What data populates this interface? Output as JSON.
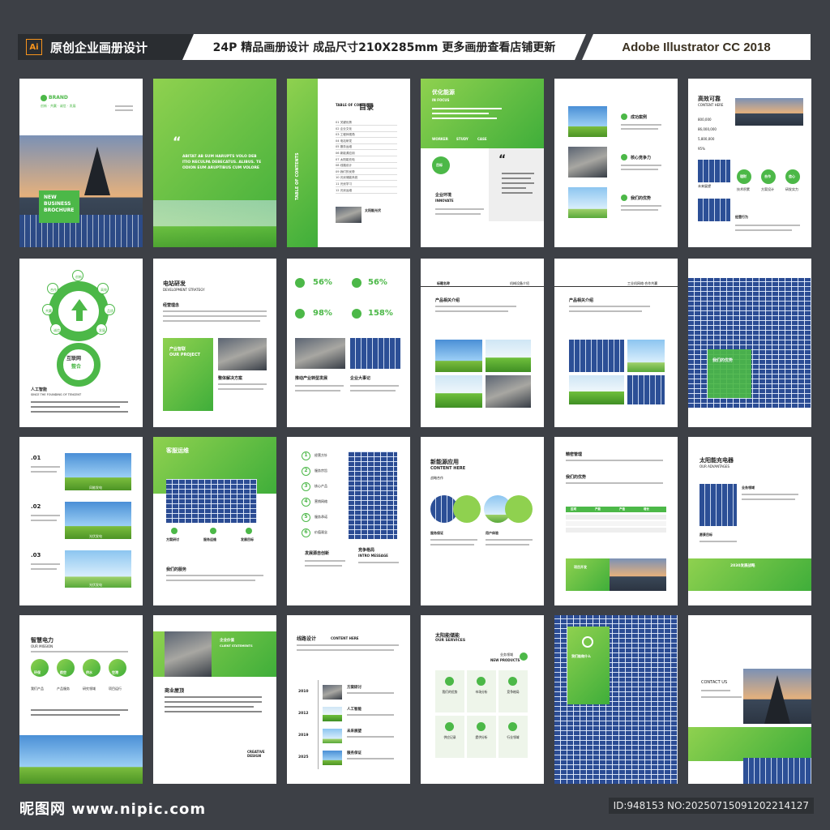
{
  "header": {
    "app_badge": "Ai",
    "left_title": "原创企业画册设计",
    "center_text": "24P 精品画册设计 成品尺寸210X285mm 更多画册查看店铺更新",
    "right_text": "Adobe Illustrator CC 2018"
  },
  "footer": {
    "site": "昵图网 www.nipic.com",
    "id_text": "ID:948153 NO:20250715091202214127"
  },
  "p1": {
    "brand": "BRAND",
    "tagline": "创新 · 共赢 · 诚信 · 发展",
    "cover_title_1": "NEW",
    "cover_title_2": "BUSINESS",
    "cover_title_3": "BROCHURE"
  },
  "p2": {
    "quote": "“",
    "body": "ABITAT AB SUM HARUPTS VOLO DEB ITIO NECULPA DEBECATUS. ALIBUS. TE ODION EUM ARUPTIBUS CUM VOLORE"
  },
  "p3": {
    "side": "TABLE OF CONTENTS",
    "toc_en": "TABLE OF CONTENTS",
    "toc_cn": "目录",
    "items": [
      "01 关键优势",
      "02 企业文化",
      "03 工程师视角",
      "04 电站研发",
      "05 服务运维",
      "06 新能源应用",
      "07 太阳能充电",
      "08 线路设计",
      "09 我们的优势",
      "10 光伏储能系统",
      "11 光伏学习",
      "12 光伏运维"
    ],
    "caption": "太阳能光伏"
  },
  "p4": {
    "title": "优化能源",
    "subtitle": "IN FOCUS",
    "tabs": [
      "WORKER",
      "STUDY",
      "CASE"
    ],
    "badge": "目标",
    "label": "企业环境",
    "label_en": "INNOVATE"
  },
  "p5": {
    "items": [
      "成功案例",
      "核心竞争力",
      "我们的优势"
    ]
  },
  "p6": {
    "title": "高效可靠",
    "subtitle": "CONTENT HERE",
    "stats": [
      "800,000",
      "86,000,000",
      "5,800,000",
      "95%"
    ],
    "icons": [
      "理财",
      "合作",
      "信心"
    ],
    "labels": [
      "未来展望",
      "技术积累",
      "方案设计",
      "研发实力"
    ],
    "footer": "经营行为"
  },
  "p7": {
    "nodes": [
      "创新",
      "合作",
      "高效",
      "共赢",
      "品质",
      "诚信",
      "发展"
    ],
    "center_1": "互联网",
    "center_2": "整合",
    "title": "人工智能",
    "subtitle": "SINCE THE FOUNDING OF TENCENT"
  },
  "p8": {
    "title": "电站研发",
    "subtitle": "DEVELOPMENT STRATEGY",
    "head": "经营理念",
    "box_title": "产业智联",
    "box_en": "OUR PROJECT",
    "label": "整体解决方案"
  },
  "p9": {
    "stats": [
      "56%",
      "56%",
      "98%",
      "158%"
    ],
    "labels": [
      "推动产业转型发展",
      "企业大事记"
    ]
  },
  "p10": {
    "tag": "标题名称",
    "right": "机械设备介绍",
    "title": "产品相关介绍"
  },
  "p11": {
    "right": "工业机网络·合作共赢",
    "title": "产品相关介绍"
  },
  "p12": {
    "tag": "我们的优势"
  },
  "p13": {
    "nums": [
      ".01",
      ".02",
      ".03"
    ],
    "caps": [
      "风能发电",
      "光伏发电",
      "光伏发电"
    ]
  },
  "p14": {
    "title": "客服运维",
    "cols": [
      "方案研讨",
      "服务运维",
      "发展目标"
    ],
    "label": "我们的服务"
  },
  "p15": {
    "steps": [
      "经营方针",
      "服务宗旨",
      "核心产品",
      "营销网络",
      "服务承诺",
      "价值观念"
    ],
    "left": "发展源自创新",
    "right": "竞争格局",
    "right_en": "INTRO MESSAGE"
  },
  "p16": {
    "title": "新能源应用",
    "subtitle": "CONTENT HERE",
    "small": "战略合作",
    "labels": [
      "服务保证",
      "用户体验"
    ]
  },
  "p17": {
    "title": "精密管理",
    "head": "我们的优势",
    "table_head": [
      "区域",
      "产能",
      "产值",
      "增长"
    ],
    "callout": "项目开发"
  },
  "p18": {
    "title": "太阳能充电器",
    "subtitle": "OUR ADVANTAGES",
    "side1": "业务领域",
    "side2": "愿景目标",
    "bar": "2030发展战略"
  },
  "p19": {
    "title": "智慧电力",
    "subtitle": "OUR MISSION",
    "circles": [
      "环保",
      "航空",
      "供水",
      "空港"
    ],
    "labels": [
      "我们产品",
      "产品服务",
      "研究领域",
      "项目运行"
    ]
  },
  "p20": {
    "tag": "企业价值",
    "tag_en": "CLIENT STATEMENTS",
    "title": "商业屋顶",
    "creative": "CREATIVE DESIGN"
  },
  "p21": {
    "title": "线路设计",
    "subtitle": "CONTENT HERE",
    "years": [
      "2010",
      "2012",
      "2019",
      "2025"
    ],
    "labels": [
      "方案研讨",
      "人工智能",
      "未来展望",
      "服务保证"
    ]
  },
  "p22": {
    "title": "太阳能储能",
    "subtitle": "OUR SERVICES",
    "corner": "业务领域",
    "corner_en": "NEW PRODUCTS",
    "grid": [
      "我们的优势",
      "市场分析",
      "竞争格局",
      "供应记录",
      "提供分析",
      "行业领域"
    ]
  },
  "p23": {
    "tag": "我们能做什么"
  },
  "p24": {
    "title": "CONTACT US"
  },
  "colors": {
    "accent": "#4cb848",
    "accent_light": "#8fd14f",
    "bg": "#3d4046"
  }
}
